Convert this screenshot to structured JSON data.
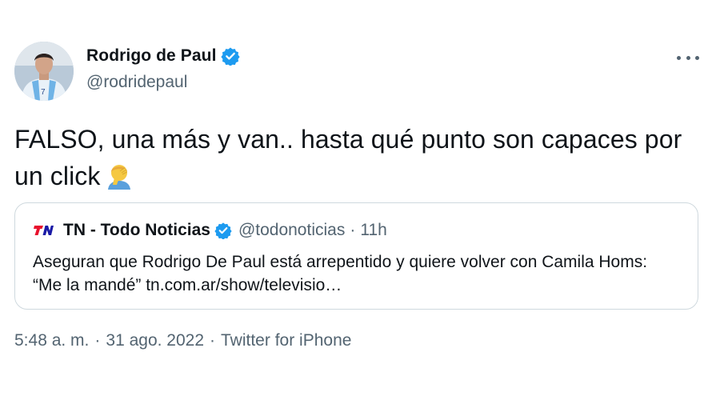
{
  "author": {
    "name": "Rodrigo de Paul",
    "handle": "@rodridepaul"
  },
  "tweet": {
    "text": "FALSO, una más y van.. hasta qué punto son capaces por un click"
  },
  "quote": {
    "name": "TN - Todo Noticias",
    "handle": "@todonoticias",
    "separator": "·",
    "time": "11h",
    "body": "Aseguran que Rodrigo De Paul está arrepentido y quiere volver con Camila Homs: “Me la mandé” tn.com.ar/show/televisio…"
  },
  "meta": {
    "time": "5:48 a. m.",
    "date": "31 ago. 2022",
    "source": "Twitter for iPhone",
    "separator": "·"
  },
  "icons": {
    "verified": "verified-badge-icon",
    "more": "more-options-icon",
    "emoji": "person-facepalming-emoji",
    "tn_logo": "tn-logo"
  },
  "colors": {
    "verified_blue": "#1d9bf0",
    "secondary_text": "#536471",
    "border": "#cfd9de"
  }
}
